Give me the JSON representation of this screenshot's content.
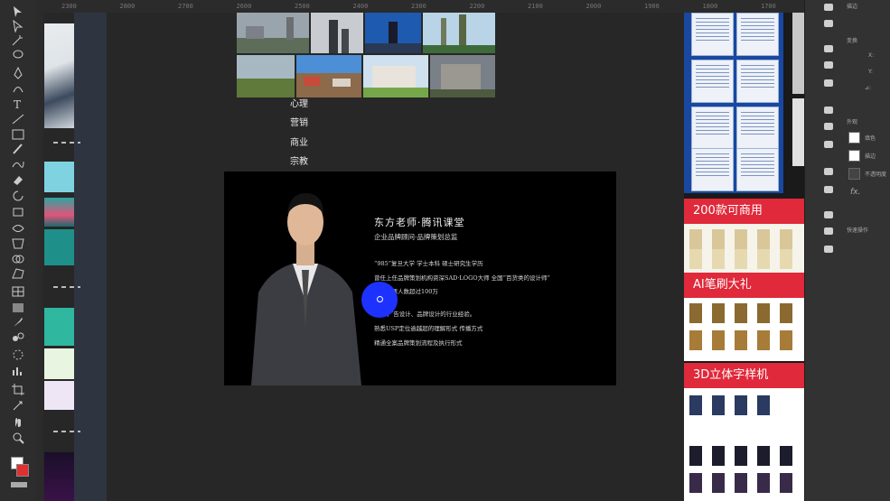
{
  "ruler": {
    "ticks": [
      "2300",
      "2800",
      "2700",
      "2600",
      "2500",
      "2400",
      "2300",
      "2200",
      "2100",
      "2000",
      "1900",
      "1800",
      "1700"
    ]
  },
  "toolbar": {
    "tools": [
      "select-tool",
      "direct-select-tool",
      "magic-wand-tool",
      "lasso-tool",
      "pen-tool",
      "curvature-tool",
      "type-tool",
      "line-tool",
      "rectangle-tool",
      "paintbrush-tool",
      "shaper-tool",
      "eraser-tool",
      "rotate-tool",
      "scale-tool",
      "width-tool",
      "free-transform-tool",
      "shape-builder-tool",
      "perspective-tool",
      "mesh-tool",
      "gradient-tool",
      "eyedropper-tool",
      "blend-tool",
      "symbol-sprayer-tool",
      "graph-tool",
      "artboard-tool",
      "slice-tool",
      "hand-tool",
      "zoom-tool"
    ]
  },
  "menu": {
    "items": [
      "心理",
      "营销",
      "商业",
      "宗教"
    ]
  },
  "slide": {
    "name": "东方老师·腾讯课堂",
    "role": "企业品牌顾问·品牌策划总监",
    "lines": [
      "“985”复旦大学 学士本科 硕士研究生学历",
      "曾任上任品牌策划机构资深SAD·LOGO大师 全国“百货类的设计师”",
      "在线听课人数超过100万",
      "10年广告设计、品牌设计的行业经验。",
      "熟悉USP定位逾越超的理解形式 传播方式",
      "精通全案品牌策划流程及执行形式"
    ]
  },
  "gallery": {
    "banners": [
      "200款可商用",
      "AI笔刷大礼",
      "3D立体字样机"
    ]
  },
  "properties": {
    "fill_label": "填色",
    "stroke_label": "描边",
    "opacity_label": "不透明度",
    "fx_label": "fx.",
    "header_label": "描边",
    "quick_label": "快速操作",
    "appearance_label": "外观",
    "transform_label": "变换",
    "x_label": "X:",
    "y_label": "Y:",
    "angle_label": "⊿:"
  },
  "colors": {
    "accent_cursor": "#1e32ff",
    "banner_red": "#e0293a"
  }
}
